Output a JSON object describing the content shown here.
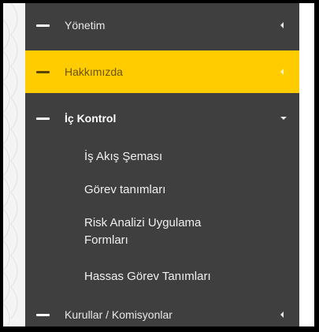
{
  "menu": {
    "items": [
      {
        "label": "Yönetim"
      },
      {
        "label": "Hakkımızda"
      },
      {
        "label": "İç Kontrol"
      },
      {
        "label": "Kurullar / Komisyonlar"
      }
    ],
    "submenu": [
      {
        "label": "İş Akış Şeması"
      },
      {
        "label": "Görev tanımları"
      },
      {
        "label": "Risk Analizi Uygulama Formları"
      },
      {
        "label": "Hassas Görev Tanımları"
      }
    ],
    "colors": {
      "background": "#3f3f3f",
      "active": "#ffcc00",
      "text": "#e9e9e9"
    }
  }
}
